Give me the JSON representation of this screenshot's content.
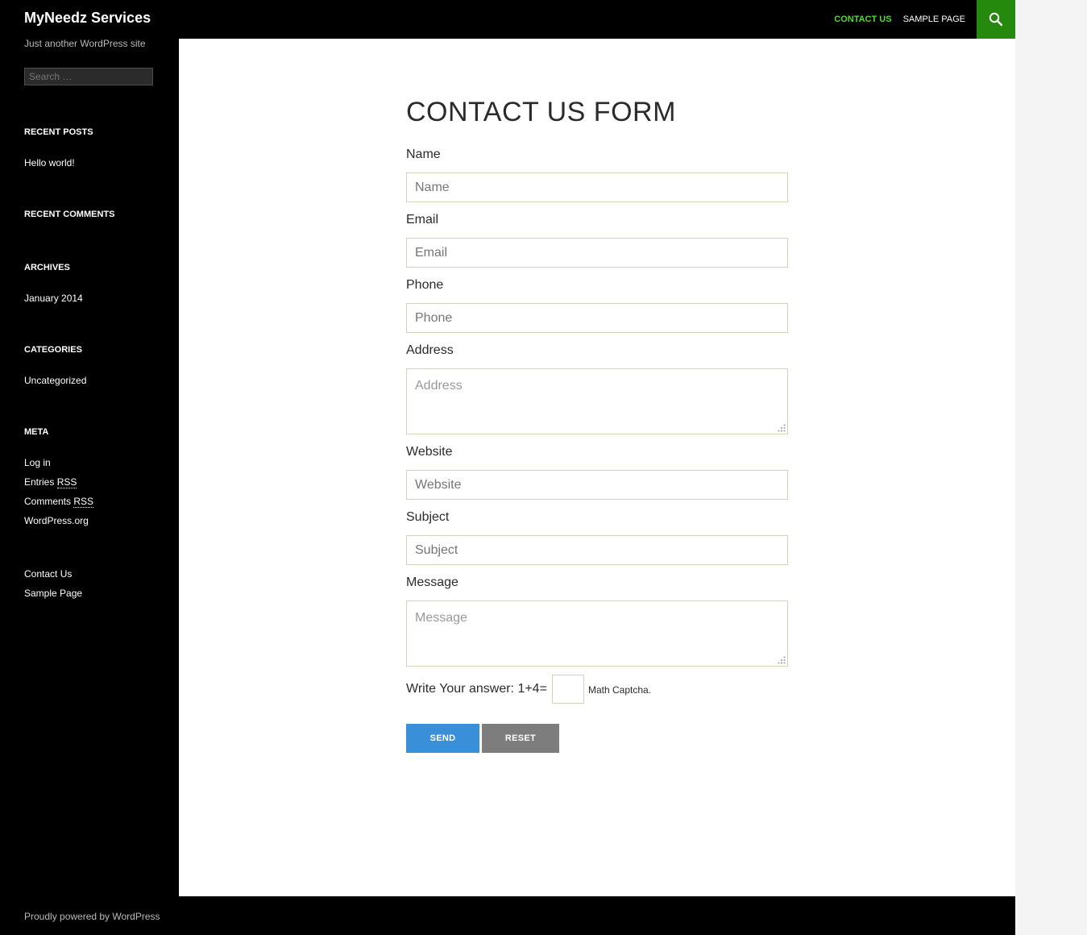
{
  "header": {
    "site_title": "MyNeedz Services",
    "tagline": "Just another WordPress site",
    "nav": [
      "CONTACT US",
      "SAMPLE PAGE"
    ],
    "accent_color": "#24890d",
    "active_nav_color": "#55d737",
    "search_icon": "search-icon"
  },
  "sidebar": {
    "search_placeholder": "Search …",
    "recent_posts_title": "RECENT POSTS",
    "recent_posts": [
      "Hello world!"
    ],
    "recent_comments_title": "RECENT COMMENTS",
    "archives_title": "ARCHIVES",
    "archives": [
      "January 2014"
    ],
    "categories_title": "CATEGORIES",
    "categories": [
      "Uncategorized"
    ],
    "meta_title": "META",
    "meta": {
      "login": "Log in",
      "entries": "Entries",
      "comments": "Comments",
      "rss": "RSS",
      "wordpress": "WordPress.org"
    },
    "pages": [
      "Contact Us",
      "Sample Page"
    ]
  },
  "form": {
    "title": "CONTACT US FORM",
    "fields": [
      {
        "label": "Name",
        "placeholder": "Name"
      },
      {
        "label": "Email",
        "placeholder": "Email"
      },
      {
        "label": "Phone",
        "placeholder": "Phone"
      },
      {
        "label": "Address",
        "placeholder": "Address"
      },
      {
        "label": "Website",
        "placeholder": "Website"
      },
      {
        "label": "Subject",
        "placeholder": "Subject"
      },
      {
        "label": "Message",
        "placeholder": "Message"
      }
    ],
    "captcha_label": "Write Your answer: 1+4=",
    "captcha_note": "Math Captcha.",
    "send_label": "SEND",
    "reset_label": "RESET",
    "send_color": "#3a8fd9",
    "reset_color": "#7d7d7d"
  },
  "footer": {
    "text": "Proudly powered by WordPress"
  }
}
